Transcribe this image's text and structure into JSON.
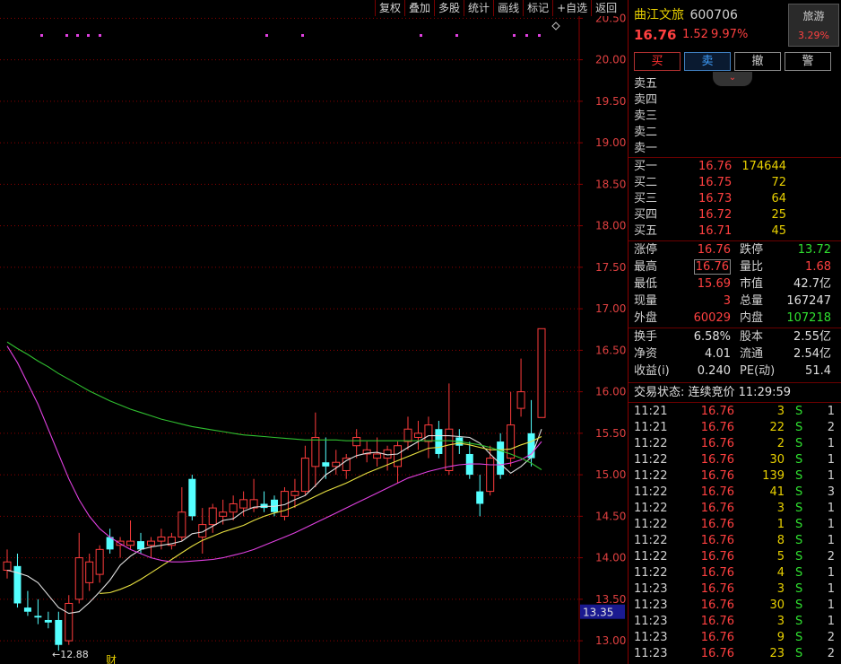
{
  "toolbar": [
    "复权",
    "叠加",
    "多股",
    "统计",
    "画线",
    "标记",
    "+自选",
    "返回"
  ],
  "stock": {
    "name": "曲江文旅",
    "code": "600706",
    "price": "16.76",
    "change": "1.52",
    "pct": "9.97%"
  },
  "sector": {
    "name": "旅游",
    "pct": "3.29%"
  },
  "actions": [
    "买",
    "卖",
    "撤",
    "警"
  ],
  "collapse_glyph": "⌄",
  "asks": [
    {
      "label": "卖五",
      "price": "",
      "vol": ""
    },
    {
      "label": "卖四",
      "price": "",
      "vol": ""
    },
    {
      "label": "卖三",
      "price": "",
      "vol": ""
    },
    {
      "label": "卖二",
      "price": "",
      "vol": ""
    },
    {
      "label": "卖一",
      "price": "",
      "vol": ""
    }
  ],
  "bids": [
    {
      "label": "买一",
      "price": "16.76",
      "vol": "174644"
    },
    {
      "label": "买二",
      "price": "16.75",
      "vol": "72"
    },
    {
      "label": "买三",
      "price": "16.73",
      "vol": "64"
    },
    {
      "label": "买四",
      "price": "16.72",
      "vol": "25"
    },
    {
      "label": "买五",
      "price": "16.71",
      "vol": "45"
    }
  ],
  "stats1": [
    {
      "l1": "涨停",
      "v1": "16.76",
      "l2": "跌停",
      "v2": "13.72"
    },
    {
      "l1": "最高",
      "v1": "16.76",
      "l2": "量比",
      "v2": "1.68"
    },
    {
      "l1": "最低",
      "v1": "15.69",
      "l2": "市值",
      "v2": "42.7亿"
    },
    {
      "l1": "现量",
      "v1": "3",
      "l2": "总量",
      "v2": "167247"
    },
    {
      "l1": "外盘",
      "v1": "60029",
      "l2": "内盘",
      "v2": "107218"
    }
  ],
  "stats2": [
    {
      "l1": "换手",
      "v1": "6.58%",
      "l2": "股本",
      "v2": "2.55亿"
    },
    {
      "l1": "净资",
      "v1": "4.01",
      "l2": "流通",
      "v2": "2.54亿"
    },
    {
      "l1": "收益(ⅰ)",
      "v1": "0.240",
      "l2": "PE(动)",
      "v2": "51.4"
    }
  ],
  "trade_status": "交易状态: 连续竞价 11:29:59",
  "ticks": [
    {
      "t": "11:21",
      "p": "16.76",
      "v": "3",
      "bs": "S",
      "n": "1"
    },
    {
      "t": "11:21",
      "p": "16.76",
      "v": "22",
      "bs": "S",
      "n": "2"
    },
    {
      "t": "11:22",
      "p": "16.76",
      "v": "2",
      "bs": "S",
      "n": "1"
    },
    {
      "t": "11:22",
      "p": "16.76",
      "v": "30",
      "bs": "S",
      "n": "1"
    },
    {
      "t": "11:22",
      "p": "16.76",
      "v": "139",
      "bs": "S",
      "n": "1"
    },
    {
      "t": "11:22",
      "p": "16.76",
      "v": "41",
      "bs": "S",
      "n": "3"
    },
    {
      "t": "11:22",
      "p": "16.76",
      "v": "3",
      "bs": "S",
      "n": "1"
    },
    {
      "t": "11:22",
      "p": "16.76",
      "v": "1",
      "bs": "S",
      "n": "1"
    },
    {
      "t": "11:22",
      "p": "16.76",
      "v": "8",
      "bs": "S",
      "n": "1"
    },
    {
      "t": "11:22",
      "p": "16.76",
      "v": "5",
      "bs": "S",
      "n": "2"
    },
    {
      "t": "11:22",
      "p": "16.76",
      "v": "4",
      "bs": "S",
      "n": "1"
    },
    {
      "t": "11:23",
      "p": "16.76",
      "v": "3",
      "bs": "S",
      "n": "1"
    },
    {
      "t": "11:23",
      "p": "16.76",
      "v": "30",
      "bs": "S",
      "n": "1"
    },
    {
      "t": "11:23",
      "p": "16.76",
      "v": "3",
      "bs": "S",
      "n": "1"
    },
    {
      "t": "11:23",
      "p": "16.76",
      "v": "9",
      "bs": "S",
      "n": "2"
    },
    {
      "t": "11:23",
      "p": "16.76",
      "v": "23",
      "bs": "S",
      "n": "2"
    }
  ],
  "chart_data": {
    "type": "candlestick",
    "y_ticks": [
      "20.50",
      "20.00",
      "19.50",
      "19.00",
      "18.50",
      "18.00",
      "17.50",
      "17.00",
      "16.50",
      "16.00",
      "15.50",
      "15.00",
      "14.50",
      "14.00",
      "13.50",
      "13.00"
    ],
    "ylim": [
      12.72,
      20.72
    ],
    "grid": "horizontal dotted",
    "current_price_label": "13.35",
    "low_marker": "←12.88",
    "bottom_marker": "财",
    "candles": [
      {
        "o": 13.85,
        "h": 14.1,
        "l": 13.75,
        "c": 13.95
      },
      {
        "o": 13.9,
        "h": 14.05,
        "l": 13.4,
        "c": 13.45
      },
      {
        "o": 13.4,
        "h": 13.6,
        "l": 13.3,
        "c": 13.35
      },
      {
        "o": 13.3,
        "h": 13.5,
        "l": 13.2,
        "c": 13.28
      },
      {
        "o": 13.25,
        "h": 13.35,
        "l": 13.15,
        "c": 13.22
      },
      {
        "o": 13.25,
        "h": 13.35,
        "l": 12.88,
        "c": 12.95
      },
      {
        "o": 13.0,
        "h": 13.55,
        "l": 12.95,
        "c": 13.45
      },
      {
        "o": 13.5,
        "h": 14.3,
        "l": 13.45,
        "c": 14.0
      },
      {
        "o": 13.7,
        "h": 14.05,
        "l": 13.6,
        "c": 13.95
      },
      {
        "o": 13.8,
        "h": 14.15,
        "l": 13.7,
        "c": 14.1
      },
      {
        "o": 14.25,
        "h": 14.35,
        "l": 14.05,
        "c": 14.1
      },
      {
        "o": 14.15,
        "h": 14.25,
        "l": 14.0,
        "c": 14.2
      },
      {
        "o": 14.15,
        "h": 14.45,
        "l": 14.1,
        "c": 14.2
      },
      {
        "o": 14.2,
        "h": 14.3,
        "l": 14.05,
        "c": 14.1
      },
      {
        "o": 14.15,
        "h": 14.25,
        "l": 14.0,
        "c": 14.2
      },
      {
        "o": 14.2,
        "h": 14.35,
        "l": 14.1,
        "c": 14.25
      },
      {
        "o": 14.15,
        "h": 14.3,
        "l": 14.1,
        "c": 14.25
      },
      {
        "o": 14.25,
        "h": 14.85,
        "l": 14.2,
        "c": 14.55
      },
      {
        "o": 14.95,
        "h": 15.0,
        "l": 14.45,
        "c": 14.5
      },
      {
        "o": 14.25,
        "h": 14.6,
        "l": 14.05,
        "c": 14.4
      },
      {
        "o": 14.4,
        "h": 14.65,
        "l": 14.3,
        "c": 14.6
      },
      {
        "o": 14.5,
        "h": 14.7,
        "l": 14.4,
        "c": 14.55
      },
      {
        "o": 14.55,
        "h": 14.75,
        "l": 14.45,
        "c": 14.65
      },
      {
        "o": 14.6,
        "h": 14.8,
        "l": 14.5,
        "c": 14.7
      },
      {
        "o": 14.6,
        "h": 14.95,
        "l": 14.55,
        "c": 14.7
      },
      {
        "o": 14.65,
        "h": 14.8,
        "l": 14.55,
        "c": 14.6
      },
      {
        "o": 14.7,
        "h": 14.75,
        "l": 14.5,
        "c": 14.55
      },
      {
        "o": 14.5,
        "h": 14.85,
        "l": 14.45,
        "c": 14.8
      },
      {
        "o": 14.75,
        "h": 14.95,
        "l": 14.6,
        "c": 14.8
      },
      {
        "o": 14.8,
        "h": 15.35,
        "l": 14.75,
        "c": 15.2
      },
      {
        "o": 15.1,
        "h": 15.75,
        "l": 14.85,
        "c": 15.45
      },
      {
        "o": 15.15,
        "h": 15.45,
        "l": 14.95,
        "c": 15.1
      },
      {
        "o": 15.1,
        "h": 15.3,
        "l": 15.0,
        "c": 15.15
      },
      {
        "o": 15.05,
        "h": 15.25,
        "l": 14.95,
        "c": 15.2
      },
      {
        "o": 15.35,
        "h": 15.55,
        "l": 15.2,
        "c": 15.45
      },
      {
        "o": 15.25,
        "h": 15.4,
        "l": 15.15,
        "c": 15.3
      },
      {
        "o": 15.2,
        "h": 15.45,
        "l": 15.1,
        "c": 15.25
      },
      {
        "o": 15.2,
        "h": 15.35,
        "l": 15.05,
        "c": 15.3
      },
      {
        "o": 15.1,
        "h": 15.4,
        "l": 14.9,
        "c": 15.35
      },
      {
        "o": 15.4,
        "h": 15.7,
        "l": 15.3,
        "c": 15.55
      },
      {
        "o": 15.45,
        "h": 15.65,
        "l": 15.3,
        "c": 15.5
      },
      {
        "o": 15.4,
        "h": 15.7,
        "l": 15.2,
        "c": 15.6
      },
      {
        "o": 15.55,
        "h": 15.65,
        "l": 15.2,
        "c": 15.25
      },
      {
        "o": 15.05,
        "h": 16.1,
        "l": 15.0,
        "c": 15.55
      },
      {
        "o": 15.45,
        "h": 15.55,
        "l": 15.25,
        "c": 15.35
      },
      {
        "o": 15.25,
        "h": 15.4,
        "l": 14.95,
        "c": 15.0
      },
      {
        "o": 14.8,
        "h": 15.0,
        "l": 14.5,
        "c": 14.65
      },
      {
        "o": 14.8,
        "h": 15.35,
        "l": 14.75,
        "c": 15.2
      },
      {
        "o": 15.4,
        "h": 15.5,
        "l": 14.95,
        "c": 15.0
      },
      {
        "o": 15.2,
        "h": 16.0,
        "l": 15.1,
        "c": 15.6
      },
      {
        "o": 15.8,
        "h": 16.4,
        "l": 15.7,
        "c": 16.0
      },
      {
        "o": 15.5,
        "h": 15.9,
        "l": 15.1,
        "c": 15.2
      },
      {
        "o": 15.69,
        "h": 16.76,
        "l": 15.69,
        "c": 16.76
      }
    ],
    "ma_series": [
      {
        "color": "#e0e0e0",
        "values": [
          13.85,
          13.82,
          13.78,
          13.7,
          13.55,
          13.4,
          13.33,
          13.35,
          13.46,
          13.59,
          13.73,
          13.91,
          14.02,
          14.1,
          14.13,
          14.15,
          14.17,
          14.2,
          14.29,
          14.31,
          14.38,
          14.45,
          14.47,
          14.56,
          14.61,
          14.62,
          14.62,
          14.64,
          14.7,
          14.75,
          14.87,
          15.0,
          15.08,
          15.17,
          15.23,
          15.26,
          15.27,
          15.24,
          15.25,
          15.33,
          15.4,
          15.47,
          15.47,
          15.47,
          15.46,
          15.45,
          15.38,
          15.25,
          15.13,
          15.02,
          15.1,
          15.21,
          15.55
        ]
      },
      {
        "color": "#e8e040",
        "values": [
          null,
          null,
          null,
          null,
          null,
          null,
          null,
          null,
          null,
          13.57,
          13.58,
          13.62,
          13.67,
          13.74,
          13.82,
          13.9,
          13.98,
          14.06,
          14.14,
          14.21,
          14.26,
          14.31,
          14.35,
          14.39,
          14.45,
          14.5,
          14.54,
          14.57,
          14.62,
          14.68,
          14.74,
          14.8,
          14.85,
          14.9,
          14.96,
          15.02,
          15.07,
          15.12,
          15.17,
          15.22,
          15.27,
          15.32,
          15.33,
          15.36,
          15.38,
          15.36,
          15.33,
          15.3,
          15.3,
          15.31,
          15.36,
          15.4,
          15.46
        ]
      },
      {
        "color": "#e040e0",
        "values": [
          16.55,
          16.35,
          16.1,
          15.85,
          15.55,
          15.25,
          14.95,
          14.7,
          14.5,
          14.35,
          14.25,
          14.17,
          14.1,
          14.05,
          14.0,
          13.97,
          13.95,
          13.95,
          13.96,
          13.97,
          13.98,
          14.0,
          14.03,
          14.06,
          14.1,
          14.15,
          14.2,
          14.25,
          14.3,
          14.36,
          14.42,
          14.48,
          14.54,
          14.6,
          14.66,
          14.72,
          14.78,
          14.84,
          14.9,
          14.96,
          15.0,
          15.04,
          15.07,
          15.1,
          15.12,
          15.13,
          15.13,
          15.12,
          15.12,
          15.14,
          15.18,
          15.25,
          15.4
        ]
      },
      {
        "color": "#30c030",
        "values": [
          16.6,
          16.52,
          16.45,
          16.37,
          16.3,
          16.22,
          16.15,
          16.08,
          16.01,
          15.95,
          15.89,
          15.84,
          15.79,
          15.75,
          15.71,
          15.67,
          15.64,
          15.61,
          15.58,
          15.56,
          15.54,
          15.52,
          15.5,
          15.48,
          15.47,
          15.46,
          15.45,
          15.44,
          15.43,
          15.42,
          15.42,
          15.42,
          15.42,
          15.41,
          15.41,
          15.41,
          15.41,
          15.41,
          15.41,
          15.41,
          15.41,
          15.41,
          15.41,
          15.41,
          15.4,
          15.38,
          15.36,
          15.33,
          15.29,
          15.25,
          15.2,
          15.14,
          15.06
        ]
      }
    ]
  }
}
